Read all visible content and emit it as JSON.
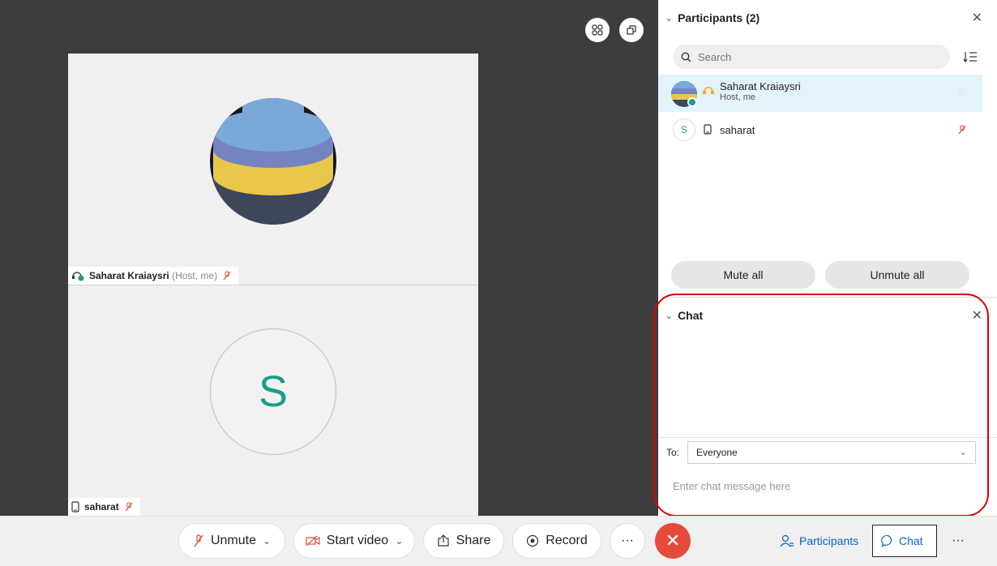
{
  "stage": {
    "tiles": [
      {
        "name": "Saharat Kraiaysri",
        "role": "(Host, me)"
      },
      {
        "name": "saharat",
        "initial": "S"
      }
    ]
  },
  "toolbar": {
    "unmute_label": "Unmute",
    "start_video_label": "Start video",
    "share_label": "Share",
    "record_label": "Record",
    "more_label": "···",
    "participants_label": "Participants",
    "chat_label": "Chat"
  },
  "participants_panel": {
    "title": "Participants (2)",
    "search_placeholder": "Search",
    "rows": [
      {
        "name": "Saharat Kraiaysri",
        "sub": "Host, me"
      },
      {
        "name": "saharat",
        "initial": "S"
      }
    ],
    "mute_all_label": "Mute all",
    "unmute_all_label": "Unmute all"
  },
  "chat_panel": {
    "title": "Chat",
    "to_label": "To:",
    "to_value": "Everyone",
    "input_placeholder": "Enter chat message here"
  },
  "colors": {
    "accent": "#0a62c9",
    "danger": "#e64a3b",
    "highlight": "#e3f3fb",
    "avatar_teal": "#17a087"
  }
}
